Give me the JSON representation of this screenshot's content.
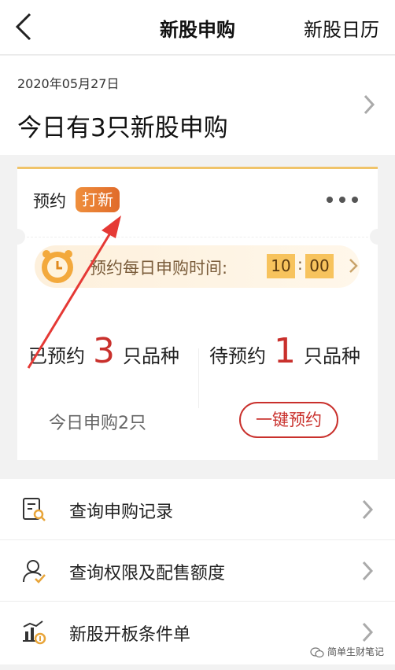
{
  "header": {
    "title": "新股申购",
    "right_link": "新股日历"
  },
  "date_card": {
    "date": "2020年05月27日",
    "summary": "今日有3只新股申购"
  },
  "ipo_card": {
    "label": "预约",
    "tag": "打新",
    "banner": {
      "text": "预约每日申购时间:",
      "hour": "10",
      "separator": ":",
      "minute": "00"
    },
    "reserved": {
      "label": "已预约",
      "count": "3",
      "unit": "只品种"
    },
    "pending": {
      "label": "待预约",
      "count": "1",
      "unit": "只品种"
    },
    "today_count": "今日申购2只",
    "one_click_label": "一键预约"
  },
  "menu": [
    {
      "label": "查询申购记录",
      "icon": "document-search-icon"
    },
    {
      "label": "查询权限及配售额度",
      "icon": "user-check-icon"
    },
    {
      "label": "新股开板条件单",
      "icon": "chart-condition-icon"
    }
  ],
  "watermark": "简单生财笔记",
  "colors": {
    "accent_red": "#c9302c",
    "tag_orange": "#e06b2a",
    "banner_bg": "#fdf0dc",
    "time_box": "#f7c35d",
    "annotation_arrow": "#e53935"
  }
}
